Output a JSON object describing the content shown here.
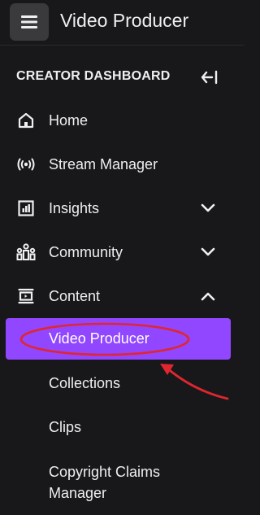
{
  "header": {
    "menu_icon": "hamburger-icon",
    "title": "Video Producer"
  },
  "dashboard": {
    "title": "CREATOR DASHBOARD",
    "collapse_icon": "collapse-left-icon"
  },
  "nav": {
    "items": [
      {
        "label": "Home",
        "icon": "home-icon",
        "chevron": null
      },
      {
        "label": "Stream Manager",
        "icon": "broadcast-icon",
        "chevron": null
      },
      {
        "label": "Insights",
        "icon": "chart-icon",
        "chevron": "down"
      },
      {
        "label": "Community",
        "icon": "people-icon",
        "chevron": "down"
      },
      {
        "label": "Content",
        "icon": "content-icon",
        "chevron": "up"
      }
    ],
    "content_subitems": [
      {
        "label": "Video Producer",
        "active": true
      },
      {
        "label": "Collections",
        "active": false
      },
      {
        "label": "Clips",
        "active": false
      },
      {
        "label": "Copyright Claims Manager",
        "active": false
      }
    ]
  },
  "colors": {
    "background": "#18181b",
    "accent": "#9147ff",
    "annotation": "#e0262f",
    "text": "#efeff1"
  }
}
